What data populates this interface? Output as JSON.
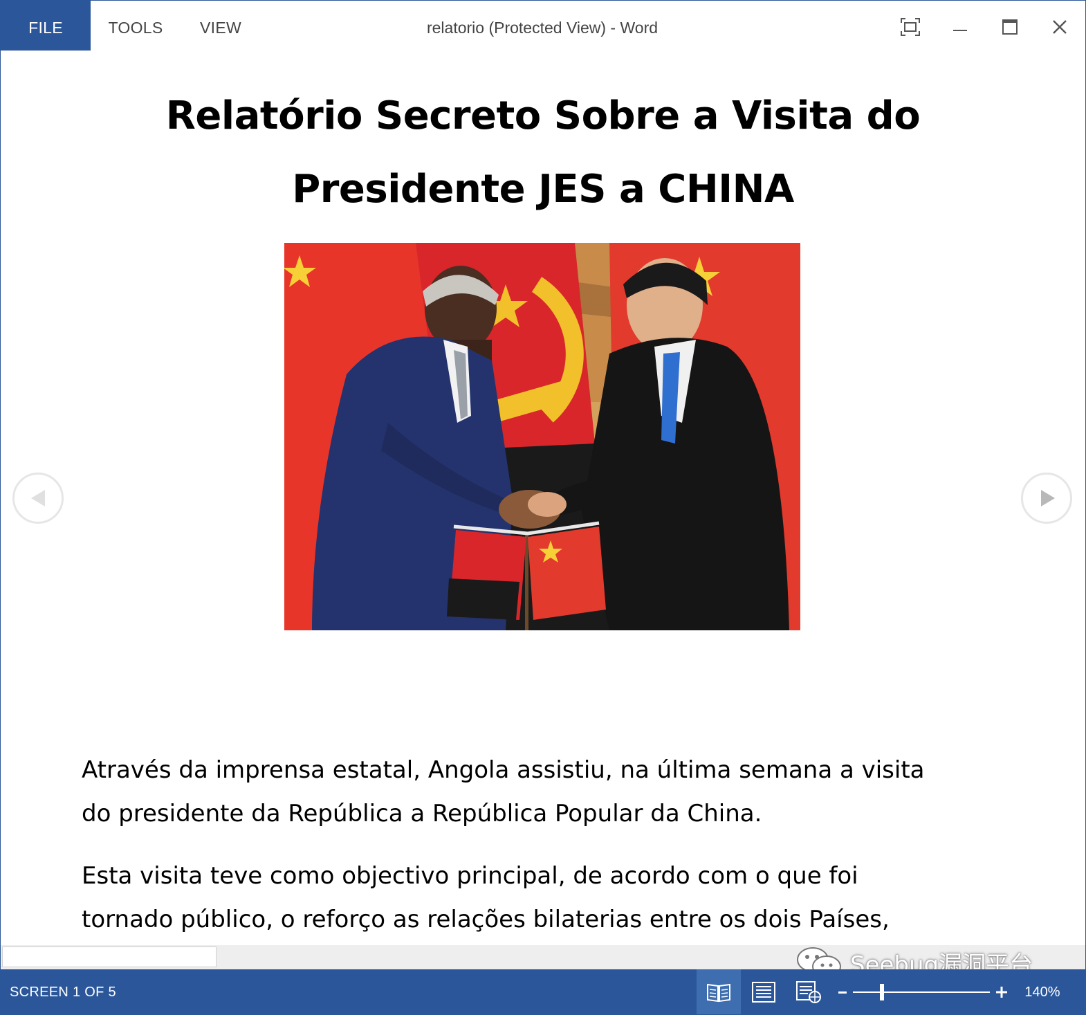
{
  "titlebar": {
    "menu": {
      "file": "FILE",
      "tools": "TOOLS",
      "view": "VIEW"
    },
    "window_title": "relatorio (Protected View) - Word",
    "buttons": [
      "full-screen-icon",
      "minimize-icon",
      "maximize-icon",
      "close-icon"
    ]
  },
  "document": {
    "title_lines": [
      "Relatório Secreto Sobre a Visita do",
      "Presidente JES a CHINA"
    ],
    "photo": {
      "icon": "photo-two-men-handshake-flags"
    },
    "paragraphs": [
      [
        "Através da imprensa estatal, Angola assistiu, na última semana  a visita",
        "do presidente da República a República Popular da China."
      ],
      [
        "Esta visita teve como objectivo principal, de acordo com o que foi",
        "tornado público, o reforço as relações bilaterias entre os dois Países,"
      ]
    ]
  },
  "navigation": {
    "prev_icon": "chevron-left-icon",
    "next_icon": "chevron-right-icon"
  },
  "watermark": {
    "icon": "wechat-icon",
    "text": "Seebug漏洞平台"
  },
  "statusbar": {
    "screen_label": "SCREEN 1 OF 5",
    "view_modes": [
      "read-mode-icon",
      "print-layout-icon",
      "web-layout-icon"
    ],
    "active_view": "read-mode-icon",
    "zoom": {
      "minus": "-",
      "plus": "+",
      "level_text": "140%",
      "slider_fraction": 0.21
    }
  },
  "colors": {
    "accent": "#2b579a",
    "accent_active": "#3e6db0",
    "text": "#000000",
    "menu_text": "#444444"
  }
}
